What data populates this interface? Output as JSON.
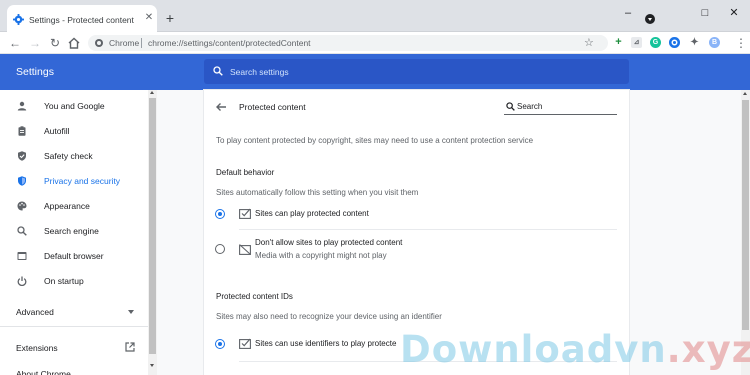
{
  "browser": {
    "tab": {
      "title": "Settings - Protected content",
      "close_icon": "close-icon"
    },
    "new_tab_label": "+",
    "window_controls": {
      "minimize": "–",
      "maximize": "□",
      "close": "✕"
    },
    "address": {
      "host": "Chrome",
      "url": "chrome://settings/content/protectedContent"
    },
    "profile_initial": "B",
    "menu_glyph": "⋮"
  },
  "header": {
    "title": "Settings",
    "search_placeholder": "Search settings"
  },
  "sidebar": {
    "items": [
      {
        "label": "You and Google",
        "icon": "person-icon"
      },
      {
        "label": "Autofill",
        "icon": "clipboard-icon"
      },
      {
        "label": "Safety check",
        "icon": "shield-check-icon"
      },
      {
        "label": "Privacy and security",
        "icon": "shield-icon",
        "active": true
      },
      {
        "label": "Appearance",
        "icon": "palette-icon"
      },
      {
        "label": "Search engine",
        "icon": "search-icon"
      },
      {
        "label": "Default browser",
        "icon": "browser-icon"
      },
      {
        "label": "On startup",
        "icon": "power-icon"
      }
    ],
    "advanced": "Advanced",
    "extensions": "Extensions",
    "about": "About Chrome"
  },
  "page": {
    "title": "Protected content",
    "search_label": "Search",
    "intro": "To play content protected by copyright, sites may need to use a content protection service",
    "default_behavior": {
      "heading": "Default behavior",
      "subtext": "Sites automatically follow this setting when you visit them",
      "options": [
        {
          "label": "Sites can play protected content",
          "selected": true
        },
        {
          "label": "Don't allow sites to play protected content",
          "sublabel": "Media with a copyright might not play",
          "selected": false
        }
      ]
    },
    "ids": {
      "heading": "Protected content IDs",
      "subtext": "Sites may also need to recognize your device using an identifier",
      "option": {
        "label": "Sites can use identifiers to play protecte",
        "selected": true
      }
    }
  },
  "watermark": {
    "main": "Downloadvn",
    "tld": ".xyz"
  },
  "colors": {
    "header_blue": "#3367d6",
    "search_blue": "#2a56c6",
    "accent": "#1a73e8"
  }
}
